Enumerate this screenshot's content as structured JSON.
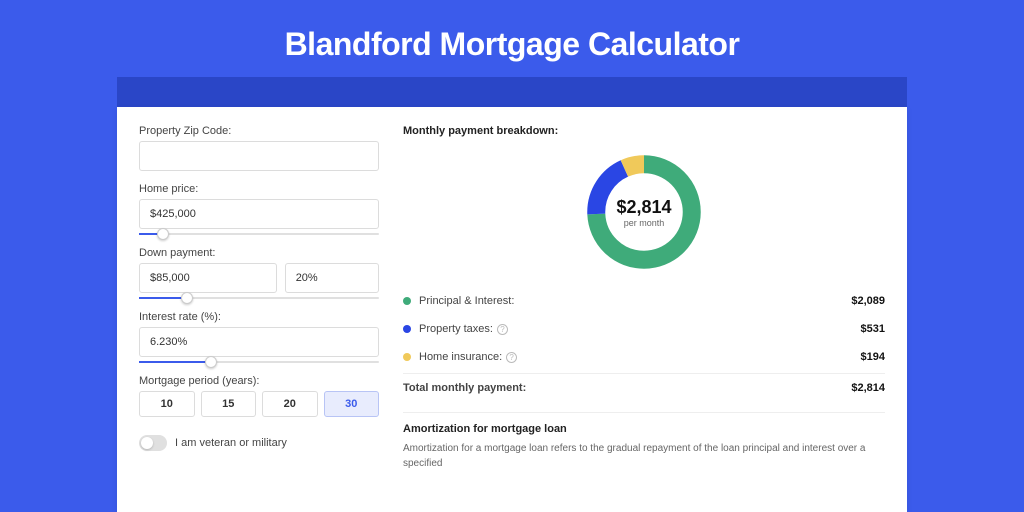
{
  "title": "Blandford Mortgage Calculator",
  "form": {
    "zip_label": "Property Zip Code:",
    "zip_value": "",
    "home_price_label": "Home price:",
    "home_price_value": "$425,000",
    "down_payment_label": "Down payment:",
    "down_payment_value": "$85,000",
    "down_payment_pct": "20%",
    "interest_label": "Interest rate (%):",
    "interest_value": "6.230%",
    "period_label": "Mortgage period (years):",
    "periods": [
      "10",
      "15",
      "20",
      "30"
    ],
    "period_selected": "30",
    "military_label": "I am veteran or military"
  },
  "breakdown": {
    "head": "Monthly payment breakdown:",
    "total_amount": "$2,814",
    "per_month": "per month",
    "rows": [
      {
        "label": "Principal & Interest:",
        "value": "$2,089",
        "color": "#3fab7a"
      },
      {
        "label": "Property taxes:",
        "value": "$531",
        "color": "#2a46e4",
        "info": true
      },
      {
        "label": "Home insurance:",
        "value": "$194",
        "color": "#f0c95a",
        "info": true
      }
    ],
    "total_label": "Total monthly payment:",
    "total_value": "$2,814"
  },
  "amortization": {
    "head": "Amortization for mortgage loan",
    "text": "Amortization for a mortgage loan refers to the gradual repayment of the loan principal and interest over a specified"
  },
  "chart_data": {
    "type": "pie",
    "title": "Monthly payment breakdown",
    "series": [
      {
        "name": "Principal & Interest",
        "value": 2089,
        "color": "#3fab7a"
      },
      {
        "name": "Property taxes",
        "value": 531,
        "color": "#2a46e4"
      },
      {
        "name": "Home insurance",
        "value": 194,
        "color": "#f0c95a"
      }
    ],
    "total": 2814,
    "center_label": "$2,814 per month"
  }
}
